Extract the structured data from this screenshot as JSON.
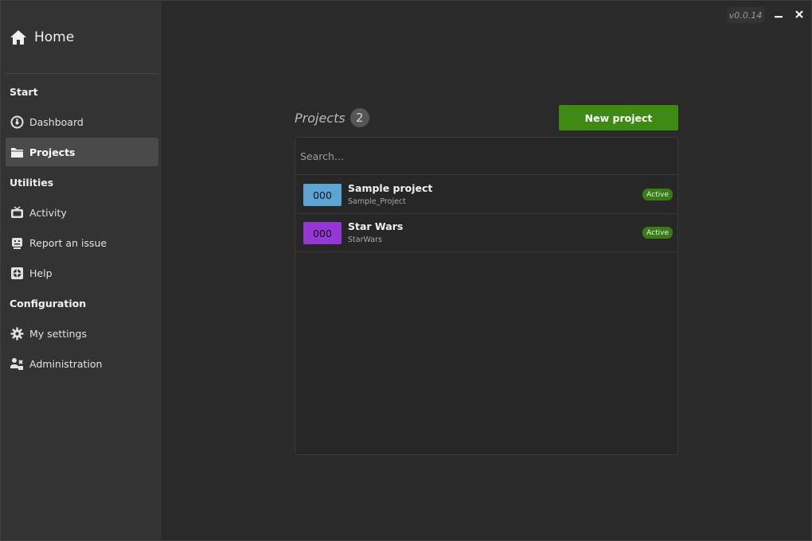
{
  "app": {
    "version": "v0.0.14"
  },
  "sidebar": {
    "home_label": "Home",
    "sections": {
      "start": "Start",
      "utilities": "Utilities",
      "configuration": "Configuration"
    },
    "items": [
      {
        "label": "Dashboard",
        "icon": "dashboard-gauge-icon"
      },
      {
        "label": "Projects",
        "icon": "folder-icon",
        "active": true
      },
      {
        "label": "Activity",
        "icon": "tv-icon"
      },
      {
        "label": "Report an issue",
        "icon": "robot-icon"
      },
      {
        "label": "Help",
        "icon": "lifebuoy-icon"
      },
      {
        "label": "My settings",
        "icon": "gear-icon"
      },
      {
        "label": "Administration",
        "icon": "admin-tools-icon"
      }
    ]
  },
  "main": {
    "title": "Projects",
    "count": "2",
    "new_button_label": "New project",
    "search_placeholder": "Search...",
    "projects": [
      {
        "code": "000",
        "name": "Sample project",
        "key": "Sample_Project",
        "status": "Active",
        "color": "#5ba4d4"
      },
      {
        "code": "000",
        "name": "Star Wars",
        "key": "StarWars",
        "status": "Active",
        "color": "#9437d4"
      }
    ]
  },
  "colors": {
    "accent_green": "#3e8a12",
    "sidebar_bg": "#333333",
    "main_bg": "#2a2a2a"
  }
}
